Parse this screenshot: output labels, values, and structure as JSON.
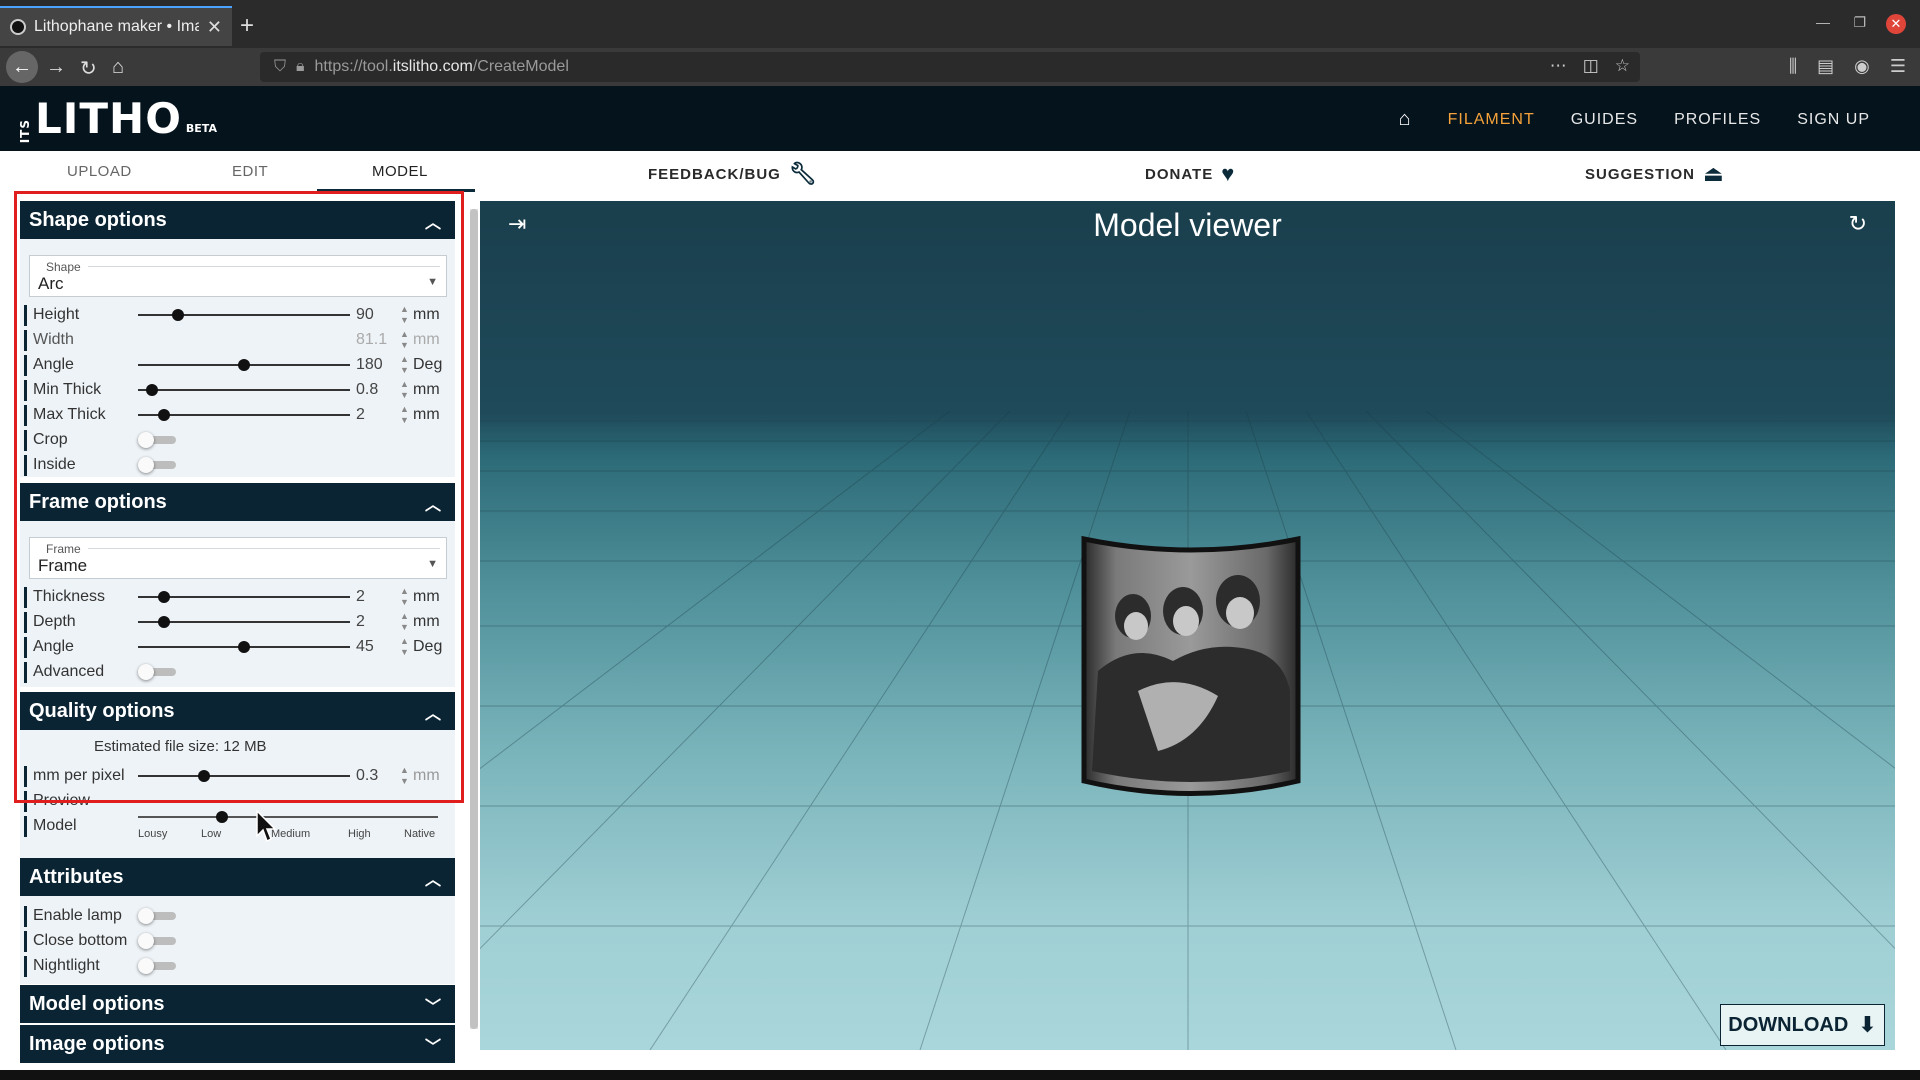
{
  "browser": {
    "tab_title": "Lithophane maker • Image...",
    "url_prefix": "https://tool.",
    "url_host": "itslitho.com",
    "url_path": "/CreateModel"
  },
  "site": {
    "logo_its": "ITS",
    "logo_main": "LITHO",
    "logo_beta": "BETA",
    "nav": {
      "filament": "FILAMENT",
      "guides": "GUIDES",
      "profiles": "PROFILES",
      "signup": "SIGN UP"
    },
    "accent_color": "#f5a23a",
    "header_color": "#05131d"
  },
  "tabs": {
    "upload": "UPLOAD",
    "edit": "EDIT",
    "model": "MODEL",
    "feedback": "FEEDBACK/BUG",
    "donate": "DONATE",
    "suggestion": "SUGGESTION"
  },
  "shape_options": {
    "title": "Shape options",
    "shape_caption": "Shape",
    "shape_value": "Arc",
    "height": {
      "label": "Height",
      "value": "90",
      "unit": "mm",
      "fraction": 0.17
    },
    "width": {
      "label": "Width",
      "value": "81.1",
      "unit": "mm"
    },
    "angle": {
      "label": "Angle",
      "value": "180",
      "unit": "Deg",
      "fraction": 0.5
    },
    "min_thick": {
      "label": "Min Thick",
      "value": "0.8",
      "unit": "mm",
      "fraction": 0.04
    },
    "max_thick": {
      "label": "Max Thick",
      "value": "2",
      "unit": "mm",
      "fraction": 0.1
    },
    "crop": {
      "label": "Crop",
      "on": false
    },
    "inside": {
      "label": "Inside",
      "on": false
    }
  },
  "frame_options": {
    "title": "Frame options",
    "frame_caption": "Frame",
    "frame_value": "Frame",
    "thickness": {
      "label": "Thickness",
      "value": "2",
      "unit": "mm",
      "fraction": 0.1
    },
    "depth": {
      "label": "Depth",
      "value": "2",
      "unit": "mm",
      "fraction": 0.1
    },
    "angle": {
      "label": "Angle",
      "value": "45",
      "unit": "Deg",
      "fraction": 0.5
    },
    "advanced": {
      "label": "Advanced",
      "on": false
    }
  },
  "quality_options": {
    "title": "Quality options",
    "estimate": "Estimated file size: 12 MB",
    "mm_per_pixel": {
      "label": "mm per pixel",
      "value": "0.3",
      "unit": "mm",
      "fraction": 0.3
    },
    "preview_label": "Preview",
    "model_label": "Model",
    "levels": [
      "Lousy",
      "Low",
      "Medium",
      "High",
      "Native"
    ],
    "selected_level": "Low"
  },
  "attributes": {
    "title": "Attributes",
    "enable_lamp": {
      "label": "Enable lamp",
      "on": false
    },
    "close_bottom": {
      "label": "Close bottom",
      "on": false
    },
    "nightlight": {
      "label": "Nightlight",
      "on": false
    }
  },
  "model_options": {
    "title": "Model options"
  },
  "image_options": {
    "title": "Image options"
  },
  "viewer": {
    "title": "Model viewer",
    "download": "DOWNLOAD"
  }
}
